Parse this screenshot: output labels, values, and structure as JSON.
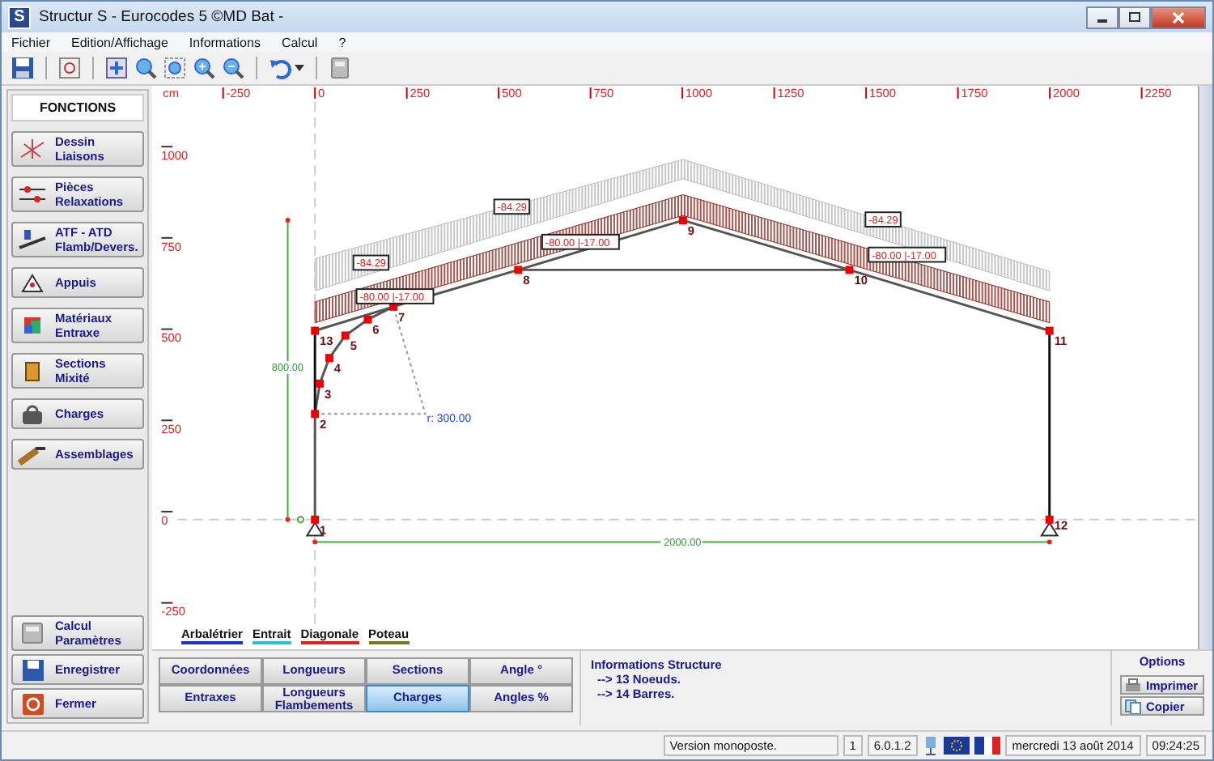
{
  "window": {
    "app_icon": "S",
    "title": "Structur S - Eurocodes 5 ©MD Bat -"
  },
  "menu": [
    "Fichier",
    "Edition/Affichage",
    "Informations",
    "Calcul",
    "?"
  ],
  "sidebar": {
    "header": "FONCTIONS",
    "items": [
      "Dessin\nLiaisons",
      "Pièces\nRelaxations",
      "ATF - ATD\nFlamb/Devers.",
      "Appuis",
      "Matériaux\nEntraxe",
      "Sections\nMixité",
      "Charges",
      "Assemblages"
    ],
    "bottom_items": [
      "Calcul\nParamètres",
      "Enregistrer",
      "Fermer"
    ]
  },
  "canvas": {
    "unit": "cm",
    "x_ruler": [
      "-250",
      "0",
      "250",
      "500",
      "750",
      "1000",
      "1250",
      "1500",
      "1750",
      "2000",
      "2250"
    ],
    "y_ruler": [
      "1000",
      "750",
      "500",
      "250",
      "0",
      "-250"
    ],
    "nodes": [
      "9",
      "8",
      "10",
      "7",
      "6",
      "13",
      "11",
      "5",
      "4",
      "3",
      "2",
      "1",
      "12"
    ],
    "load_labels": [
      "-84.29",
      "-84.29",
      "-84.29"
    ],
    "bar_load_labels": [
      "-80.00 |-17.00",
      "-80.00 |-17.00",
      "-80.00 |-17.00"
    ],
    "height_dimension": "800.00",
    "span_dimension": "2000.00",
    "radius_label": "r: 300.00"
  },
  "legend": [
    {
      "label": "Arbalétrier",
      "color": "#2233bb"
    },
    {
      "label": "Entrait",
      "color": "#33bbdd"
    },
    {
      "label": "Diagonale",
      "color": "#dd2222"
    },
    {
      "label": "Poteau",
      "color": "#777722"
    }
  ],
  "tabs": [
    {
      "label": "Coordonnées",
      "selected": false
    },
    {
      "label": "Longueurs",
      "selected": false
    },
    {
      "label": "Sections",
      "selected": false
    },
    {
      "label": "Angle °",
      "selected": false
    },
    {
      "label": "Entraxes",
      "selected": false
    },
    {
      "label": "Longueurs\nFlambements",
      "selected": false
    },
    {
      "label": "Charges",
      "selected": true
    },
    {
      "label": "Angles %",
      "selected": false
    }
  ],
  "info": {
    "title": "Informations Structure",
    "lines": [
      "--> 13 Noeuds.",
      "--> 14 Barres."
    ]
  },
  "options": {
    "title": "Options",
    "buttons": [
      "Imprimer",
      "Copier"
    ]
  },
  "status_bar": {
    "message": "Version monoposte.",
    "count": "1",
    "version": "6.0.1.2",
    "date": "mercredi 13 août 2014",
    "time": "09:24:25"
  }
}
